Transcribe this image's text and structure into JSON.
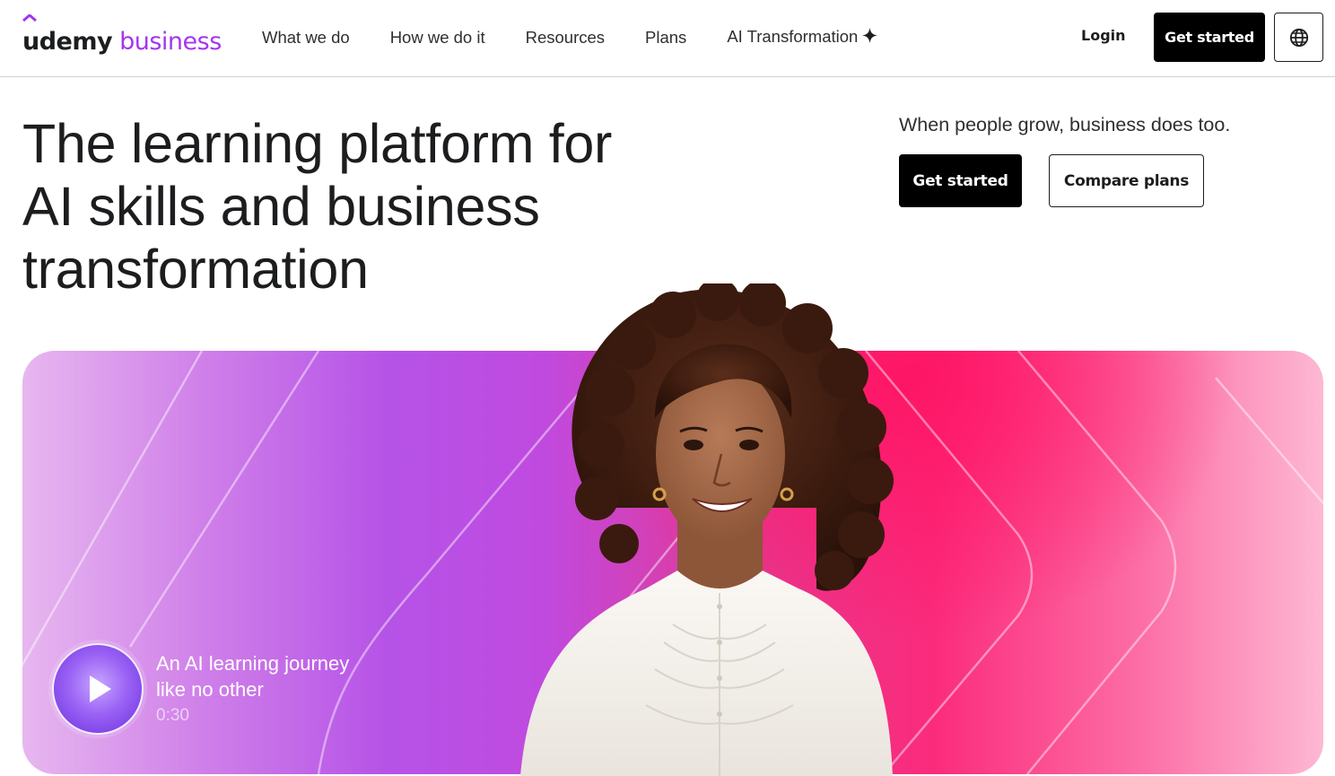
{
  "header": {
    "logo": {
      "brand": "udemy",
      "product": "business"
    },
    "nav": [
      {
        "label": "What we do"
      },
      {
        "label": "How we do it"
      },
      {
        "label": "Resources"
      },
      {
        "label": "Plans"
      },
      {
        "label": "AI Transformation",
        "icon": "sparkle-icon"
      }
    ],
    "login_label": "Login",
    "get_started_label": "Get started",
    "language_icon": "globe-icon"
  },
  "hero": {
    "headline_lines": [
      "The learning platform for",
      "AI skills and business",
      "transformation"
    ],
    "tagline": "When people grow, business does too.",
    "primary_cta": "Get started",
    "secondary_cta": "Compare plans"
  },
  "banner": {
    "video": {
      "title_lines": [
        "An AI learning journey",
        "like no other"
      ],
      "duration": "0:30",
      "play_icon": "play-icon"
    }
  },
  "colors": {
    "brand_purple": "#a435f0",
    "text_dark": "#1c1d1f",
    "button_black": "#000000",
    "banner_pink": "#fb2b7c",
    "banner_violet": "#b653e7"
  }
}
